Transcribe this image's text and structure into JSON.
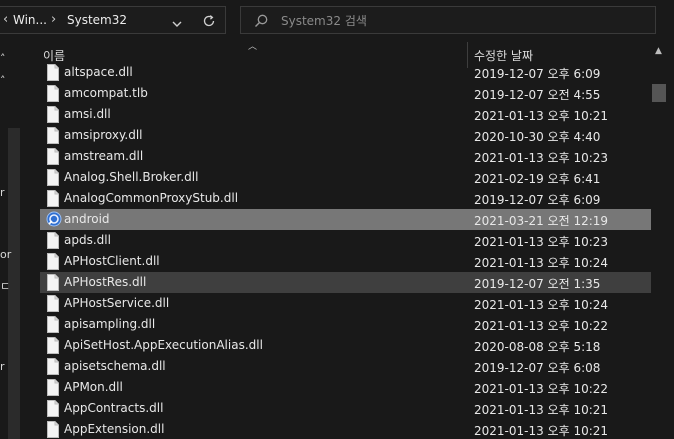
{
  "address_bar": {
    "back_chevron": "‹",
    "crumb_1": "Win...",
    "crumb_sep": "›",
    "crumb_2": "System32",
    "dropdown_icon": "chevron-down-icon",
    "refresh_icon": "refresh-icon"
  },
  "search": {
    "placeholder": "System32 검색",
    "icon": "search-icon"
  },
  "nav_pane": {
    "marks": [
      "˄",
      "˄",
      "r",
      "or",
      "ㄷ",
      "r"
    ]
  },
  "columns": {
    "name": "이름",
    "date_modified": "수정한 날짜"
  },
  "files": [
    {
      "name": "altspace.dll",
      "date": "2019-12-07 오후 6:09",
      "icon": "dll-file-icon"
    },
    {
      "name": "amcompat.tlb",
      "date": "2019-12-07 오전 4:55",
      "icon": "file-icon"
    },
    {
      "name": "amsi.dll",
      "date": "2021-01-13 오후 10:21",
      "icon": "dll-file-icon"
    },
    {
      "name": "amsiproxy.dll",
      "date": "2020-10-30 오후 4:40",
      "icon": "dll-file-icon"
    },
    {
      "name": "amstream.dll",
      "date": "2021-01-13 오후 10:23",
      "icon": "dll-file-icon"
    },
    {
      "name": "Analog.Shell.Broker.dll",
      "date": "2021-02-19 오후 6:41",
      "icon": "dll-file-icon"
    },
    {
      "name": "AnalogCommonProxyStub.dll",
      "date": "2019-12-07 오후 6:09",
      "icon": "dll-file-icon"
    },
    {
      "name": "android",
      "date": "2021-03-21 오전 12:19",
      "icon": "android-app-icon",
      "state": "selected"
    },
    {
      "name": "apds.dll",
      "date": "2021-01-13 오후 10:23",
      "icon": "dll-file-icon"
    },
    {
      "name": "APHostClient.dll",
      "date": "2021-01-13 오후 10:24",
      "icon": "dll-file-icon"
    },
    {
      "name": "APHostRes.dll",
      "date": "2019-12-07 오전 1:35",
      "icon": "dll-file-icon",
      "state": "hover"
    },
    {
      "name": "APHostService.dll",
      "date": "2021-01-13 오후 10:24",
      "icon": "dll-file-icon"
    },
    {
      "name": "apisampling.dll",
      "date": "2021-01-13 오후 10:22",
      "icon": "dll-file-icon"
    },
    {
      "name": "ApiSetHost.AppExecutionAlias.dll",
      "date": "2020-08-08 오후 5:18",
      "icon": "dll-file-icon"
    },
    {
      "name": "apisetschema.dll",
      "date": "2019-12-07 오후 6:08",
      "icon": "dll-file-icon"
    },
    {
      "name": "APMon.dll",
      "date": "2021-01-13 오후 10:22",
      "icon": "dll-file-icon"
    },
    {
      "name": "AppContracts.dll",
      "date": "2021-01-13 오후 10:21",
      "icon": "dll-file-icon"
    },
    {
      "name": "AppExtension.dll",
      "date": "2021-01-13 오후 10:21",
      "icon": "dll-file-icon"
    }
  ],
  "colors": {
    "background": "#191919",
    "selected_row": "#777777",
    "hover_row": "#3f3f3f",
    "border": "#3a3a3a"
  }
}
